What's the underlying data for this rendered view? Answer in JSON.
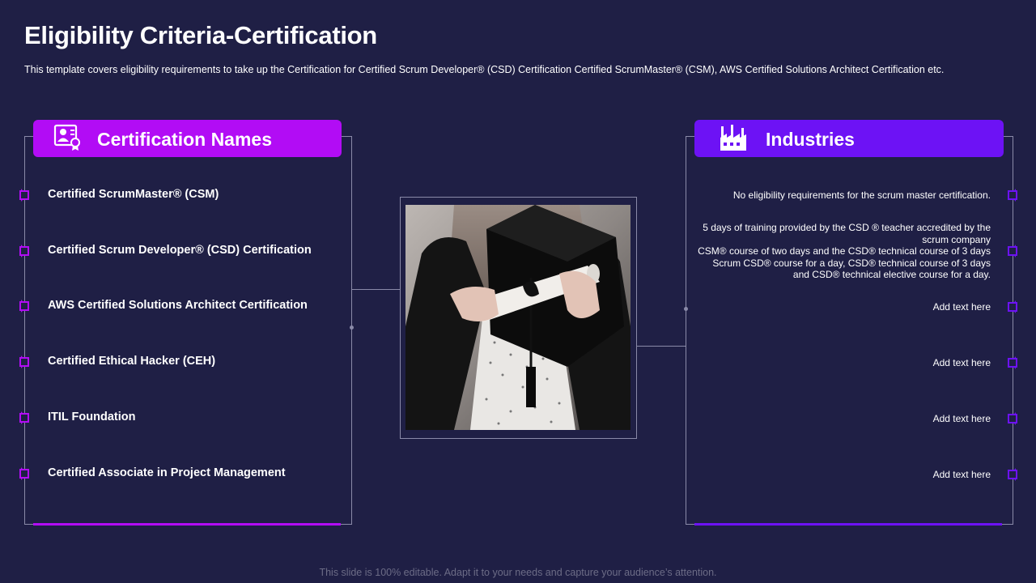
{
  "title": "Eligibility Criteria-Certification",
  "subtitle": "This template covers eligibility requirements to take up the Certification for Certified Scrum Developer® (CSD) Certification  Certified ScrumMaster® (CSM), AWS Certified Solutions Architect Certification etc.",
  "left_panel": {
    "header": "Certification Names",
    "icon": "certificate-icon",
    "accent": "#b20cf5",
    "items": [
      "Certified ScrumMaster® (CSM)",
      "Certified Scrum Developer® (CSD) Certification",
      "AWS Certified Solutions Architect Certification",
      "Certified Ethical Hacker (CEH)",
      "ITIL Foundation",
      "Certified Associate in Project Management"
    ]
  },
  "right_panel": {
    "header": "Industries",
    "icon": "factory-icon",
    "accent": "#6d12f5",
    "items": [
      "No eligibility requirements for the scrum master certification.",
      "5 days of training provided by the CSD ® teacher accredited by the scrum company\nCSM® course of two days and the CSD® technical course of 3 days\nScrum CSD® course for a day, CSD® technical course of 3 days\nand CSD® technical elective course for a day.",
      "Add text here",
      "Add text here",
      "Add text here",
      "Add text here"
    ]
  },
  "photo": "graduate-holding-cap-and-diploma",
  "footer": "This slide is 100% editable. Adapt it to your needs and capture your audience’s attention.",
  "colors": {
    "background": "#1f1f45",
    "left_accent": "#b20cf5",
    "right_accent": "#6d12f5",
    "line": "#8a8aa8"
  }
}
